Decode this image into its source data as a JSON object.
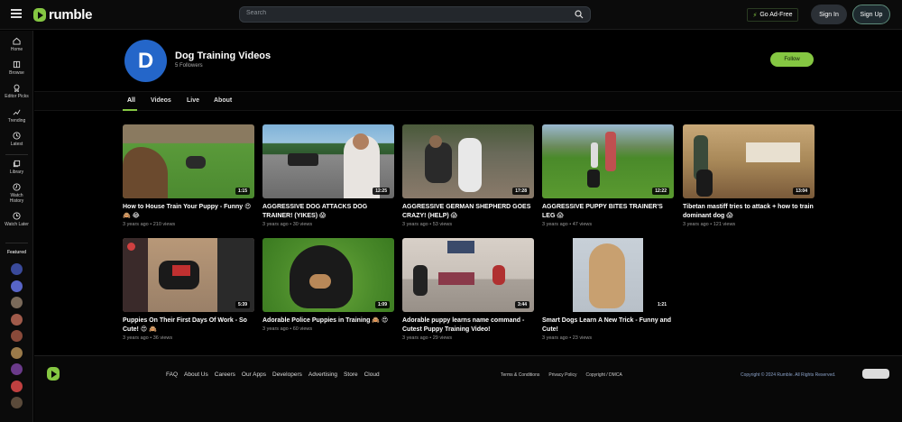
{
  "header": {
    "logo_text": "rumble",
    "search_placeholder": "Search",
    "ad_free_label": "Go Ad-Free",
    "sign_in_label": "Sign In",
    "sign_up_label": "Sign Up"
  },
  "sidebar": {
    "items": [
      {
        "label": "Home",
        "icon": "home-icon"
      },
      {
        "label": "Browse",
        "icon": "browse-icon"
      },
      {
        "label": "Editor Picks",
        "icon": "award-icon"
      },
      {
        "label": "Trending",
        "icon": "trending-icon"
      },
      {
        "label": "Latest",
        "icon": "clock-icon"
      },
      {
        "label": "Library",
        "icon": "library-icon"
      },
      {
        "label": "Watch History",
        "icon": "history-icon"
      },
      {
        "label": "Watch Later",
        "icon": "watch-later-icon"
      }
    ],
    "featured_label": "Featured",
    "featured_colors": [
      "#3a4a9a",
      "#5865c8",
      "#7a6a5a",
      "#a05a4a",
      "#8a4a3a",
      "#9a7a4a",
      "#6a3a8a",
      "#c04040",
      "#5a4a3a"
    ]
  },
  "channel": {
    "avatar_letter": "D",
    "avatar_color": "#2466c9",
    "name": "Dog Training Videos",
    "followers": "5 Followers",
    "follow_label": "Follow"
  },
  "tabs": [
    "All",
    "Videos",
    "Live",
    "About"
  ],
  "videos": [
    {
      "title": "How to House Train Your Puppy - Funny 😍 🙈 😂",
      "meta": "3 years ago • 210 views",
      "duration": "1:15"
    },
    {
      "title": "AGGRESSIVE DOG ATTACKS DOG TRAINER! (YIKES) 😱",
      "meta": "3 years ago • 30 views",
      "duration": "12:25"
    },
    {
      "title": "AGGRESSIVE GERMAN SHEPHERD GOES CRAZY! (HELP) 😱",
      "meta": "3 years ago • 53 views",
      "duration": "17:28"
    },
    {
      "title": "AGGRESSIVE PUPPY BITES TRAINER'S LEG 😱",
      "meta": "3 years ago • 47 views",
      "duration": "12:22"
    },
    {
      "title": "Tibetan mastiff tries to attack + how to train dominant dog 😱",
      "meta": "3 years ago • 121 views",
      "duration": "13:04"
    },
    {
      "title": "Puppies On Their First Days Of Work - So Cute! 😍 🙈",
      "meta": "3 years ago • 36 views",
      "duration": "5:39"
    },
    {
      "title": "Adorable Police Puppies in Training 🙈 😍",
      "meta": "3 years ago • 60 views",
      "duration": "1:09"
    },
    {
      "title": "Adorable puppy learns name command - Cutest Puppy Training Video!",
      "meta": "3 years ago • 29 views",
      "duration": "3:44"
    },
    {
      "title": "Smart Dogs Learn A New Trick - Funny and Cute!",
      "meta": "3 years ago • 23 views",
      "duration": "1:21"
    }
  ],
  "footer": {
    "links": [
      "FAQ",
      "About Us",
      "Careers",
      "Our Apps",
      "Developers",
      "Advertising",
      "Store",
      "Cloud"
    ],
    "legal": [
      "Terms & Conditions",
      "Privacy Policy",
      "Copyright / DMCA"
    ],
    "copyright": "Copyright © 2024 Rumble. All Rights Reserved."
  }
}
